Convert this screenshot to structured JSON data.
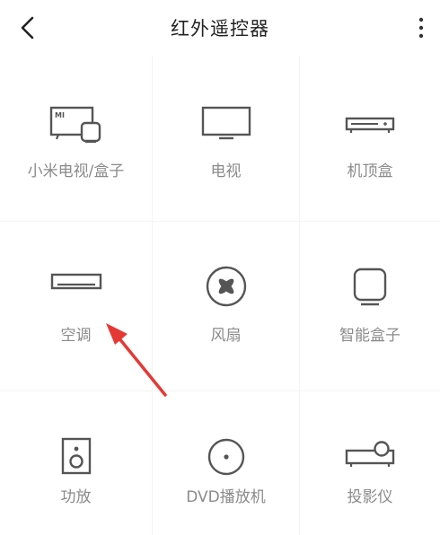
{
  "header": {
    "title": "红外遥控器"
  },
  "devices": [
    {
      "label": "小米电视/盒子",
      "icon": "mi-tv-box-icon"
    },
    {
      "label": "电视",
      "icon": "tv-icon"
    },
    {
      "label": "机顶盒",
      "icon": "set-top-box-icon"
    },
    {
      "label": "空调",
      "icon": "air-conditioner-icon"
    },
    {
      "label": "风扇",
      "icon": "fan-icon"
    },
    {
      "label": "智能盒子",
      "icon": "smart-box-icon"
    },
    {
      "label": "功放",
      "icon": "amplifier-icon"
    },
    {
      "label": "DVD播放机",
      "icon": "dvd-player-icon"
    },
    {
      "label": "投影仪",
      "icon": "projector-icon"
    }
  ],
  "logo_text": "MI",
  "colors": {
    "icon": "#555555",
    "label": "#8a8a8a",
    "title": "#222222",
    "arrow": "#e53935"
  }
}
